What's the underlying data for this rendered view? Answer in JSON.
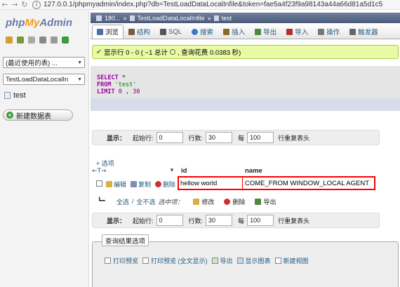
{
  "browser": {
    "url": "127.0.0.1/phpmyadmin/index.php?db=TestLoadDataLocalInfile&token=fae5a4f23f9a98143a44a66d81a5d1c5"
  },
  "sidebar": {
    "logo_php": "php",
    "logo_my": "My",
    "logo_admin": "Admin",
    "recent_select": "(最近使用的表) ...",
    "db_select": "TestLoadDataLocalIn",
    "db_item": "test",
    "new_table": "新建数据表"
  },
  "breadcrumb": {
    "server": "180...",
    "database": "TestLoadDataLocalInfile",
    "table": "test"
  },
  "tabs": [
    {
      "label": "浏览",
      "icon": "browse-icon",
      "color": "#4a6fa5"
    },
    {
      "label": "结构",
      "icon": "structure-icon",
      "color": "#7a5c3a"
    },
    {
      "label": "SQL",
      "icon": "sql-icon",
      "color": "#555555"
    },
    {
      "label": "搜索",
      "icon": "search-icon",
      "color": "#3a78c4"
    },
    {
      "label": "插入",
      "icon": "insert-icon",
      "color": "#8a6a2a"
    },
    {
      "label": "导出",
      "icon": "export-icon",
      "color": "#4b8b3b"
    },
    {
      "label": "导入",
      "icon": "import-icon",
      "color": "#b03030"
    },
    {
      "label": "操作",
      "icon": "wrench-icon",
      "color": "#777777"
    },
    {
      "label": "触发器",
      "icon": "trigger-icon",
      "color": "#666666"
    }
  ],
  "message": {
    "text": "显示行 0 - 0 ( ~1 总计 ",
    "text2": ", 查询花费 0.0383 秒)"
  },
  "sql": {
    "line1_kw": "SELECT",
    "line1_rest": " *",
    "line2_kw": "FROM",
    "line2_str": " 'test'",
    "line3_kw": "LIMIT",
    "line3_rest": " 0 , 30"
  },
  "nav": {
    "show_label": "显示：",
    "start_label": "起始行:",
    "start_value": "0",
    "rows_label": "行数:",
    "rows_value": "30",
    "every_label": "每",
    "every_value": "100",
    "repeat_label": "行重复表头"
  },
  "options_link": "+ 选项",
  "table": {
    "columns": [
      "id",
      "name"
    ],
    "rows": [
      {
        "edit": "编辑",
        "copy": "复制",
        "delete": "删除",
        "id": "hellow world",
        "name": "COME_FROM WINDOW_LOCAL AGENT"
      }
    ]
  },
  "with_selected": {
    "check_all": "全选",
    "sep": " / ",
    "uncheck_all": "全不选",
    "label": "选中项：",
    "modify": "修改",
    "delete": "删除",
    "export": "导出"
  },
  "query_results": {
    "legend": "查询结果选项",
    "print": "打印预览",
    "print_full": "打印预览 (全文显示)",
    "export": "导出",
    "chart": "显示图表",
    "view": "新建视图"
  }
}
